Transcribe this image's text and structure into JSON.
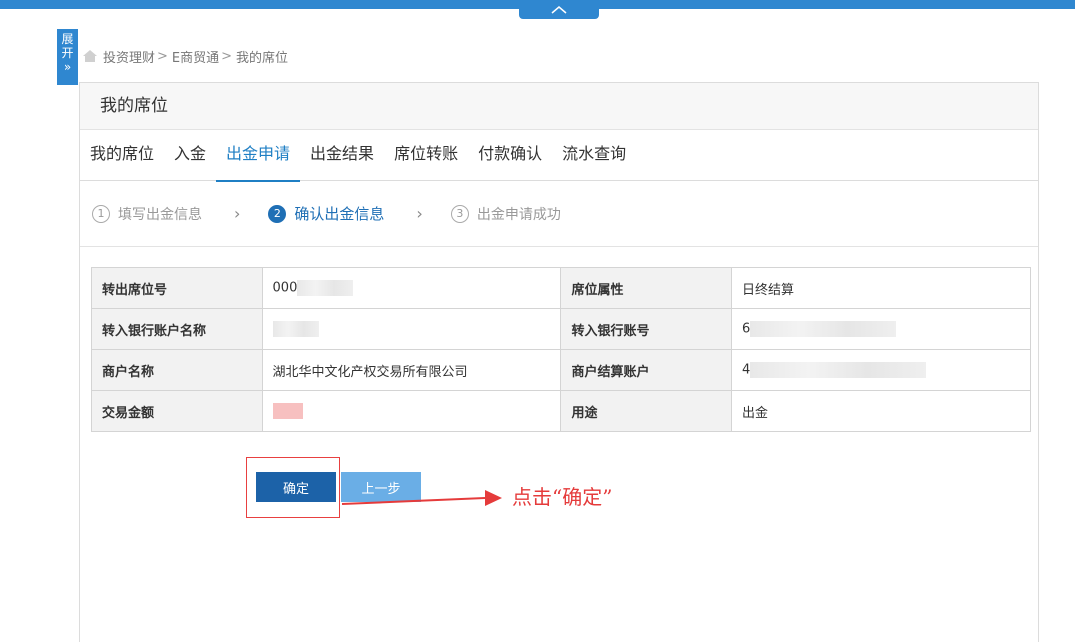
{
  "breadcrumb": {
    "items": [
      "投资理财",
      "E商贸通",
      "我的席位"
    ],
    "sep": ">"
  },
  "expand_tab": {
    "label_1": "展",
    "label_2": "开",
    "chevron": "»"
  },
  "panel": {
    "title": "我的席位"
  },
  "tabs": [
    {
      "label": "我的席位"
    },
    {
      "label": "入金"
    },
    {
      "label": "出金申请"
    },
    {
      "label": "出金结果"
    },
    {
      "label": "席位转账"
    },
    {
      "label": "付款确认"
    },
    {
      "label": "流水查询"
    }
  ],
  "steps": [
    {
      "num": "1",
      "label": "填写出金信息"
    },
    {
      "num": "2",
      "label": "确认出金信息"
    },
    {
      "num": "3",
      "label": "出金申请成功"
    }
  ],
  "table": {
    "rows": [
      {
        "l1": "转出席位号",
        "v1": "000",
        "l2": "席位属性",
        "v2": "日终结算"
      },
      {
        "l1": "转入银行账户名称",
        "v1": "",
        "l2": "转入银行账号",
        "v2": "6"
      },
      {
        "l1": "商户名称",
        "v1": "湖北华中文化产权交易所有限公司",
        "l2": "商户结算账户",
        "v2": "4"
      },
      {
        "l1": "交易金额",
        "v1": "",
        "l2": "用途",
        "v2": "出金"
      }
    ]
  },
  "buttons": {
    "confirm": "确定",
    "prev": "上一步"
  },
  "annotation": "点击“确定”",
  "colors": {
    "accent": "#1f7fc4",
    "topbar": "#2f87d0",
    "annotation": "#e53b3b"
  }
}
